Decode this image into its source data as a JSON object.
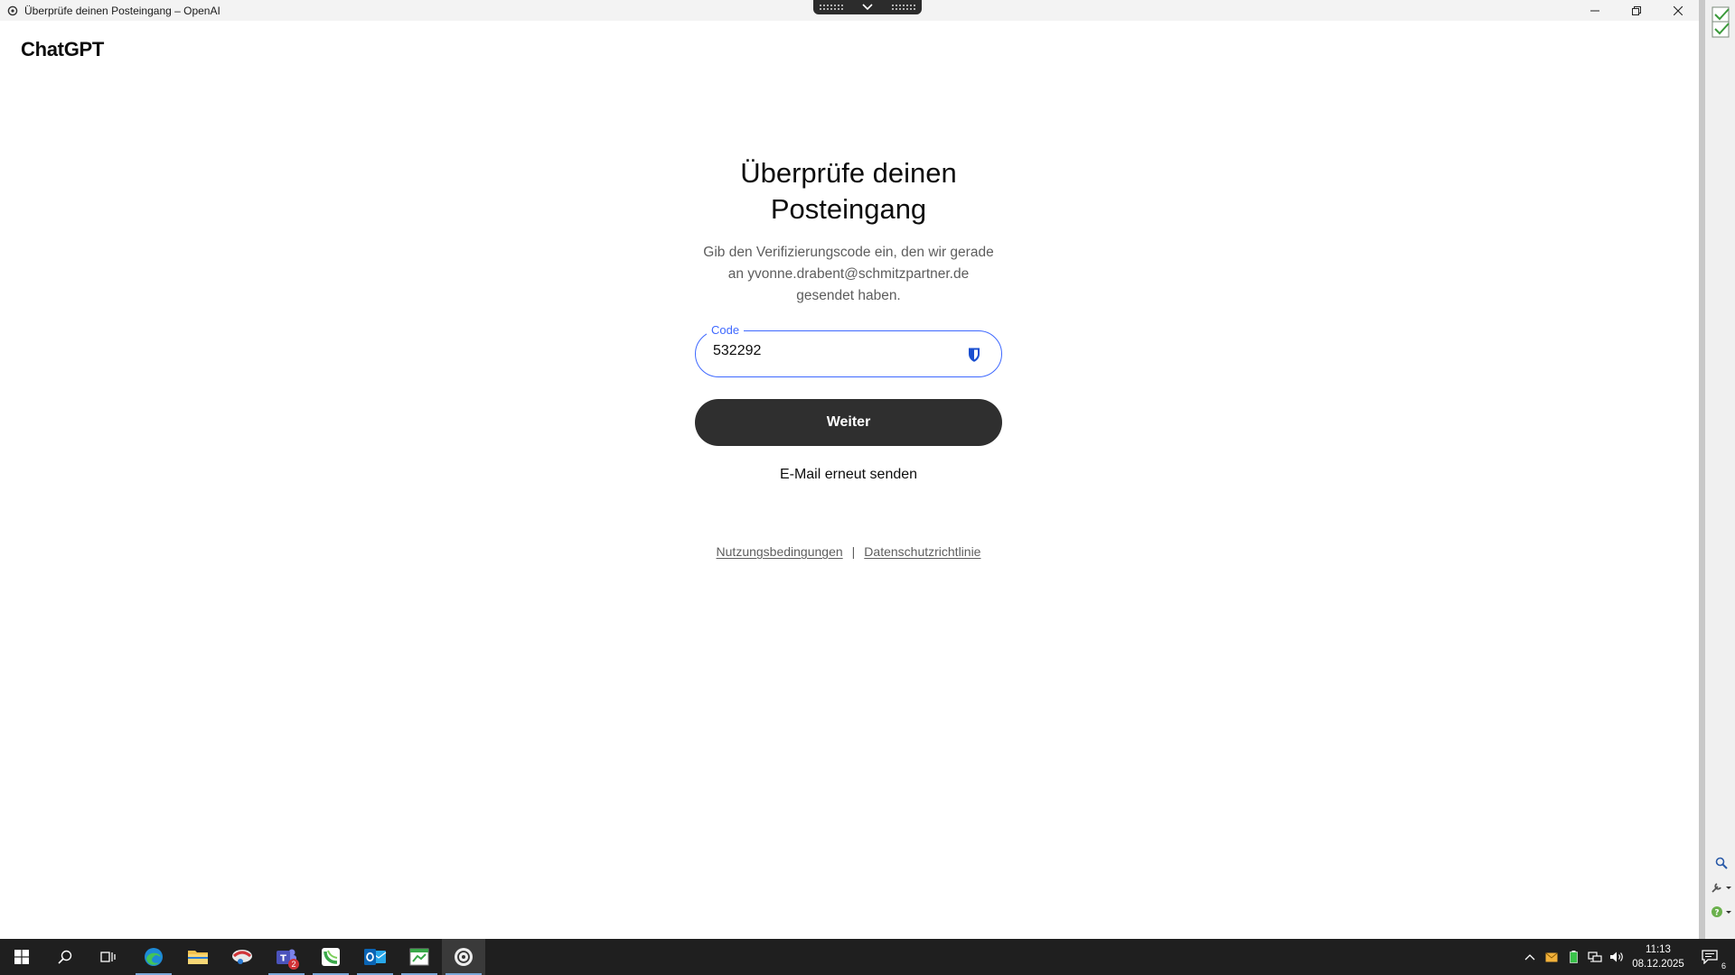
{
  "window": {
    "title": "Überprüfe deinen Posteingang – OpenAI"
  },
  "page": {
    "brand": "ChatGPT",
    "heading_line1": "Überprüfe deinen",
    "heading_line2": "Posteingang",
    "desc_line1": "Gib den Verifizierungscode ein, den wir gerade",
    "desc_line2": "an yvonne.drabent@schmitzpartner.de",
    "desc_line3": "gesendet haben.",
    "code_label": "Code",
    "code_value": "532292",
    "continue_label": "Weiter",
    "resend_label": "E-Mail erneut senden",
    "terms_link": "Nutzungsbedingungen",
    "separator": "|",
    "privacy_link": "Datenschutzrichtlinie",
    "accent_color": "#3e68ff",
    "button_color": "#2f2f2f"
  },
  "taskbar": {
    "teams_badge": "2",
    "clock_time": "11:13",
    "clock_date": "08.12.2025",
    "notification_count": "6"
  }
}
